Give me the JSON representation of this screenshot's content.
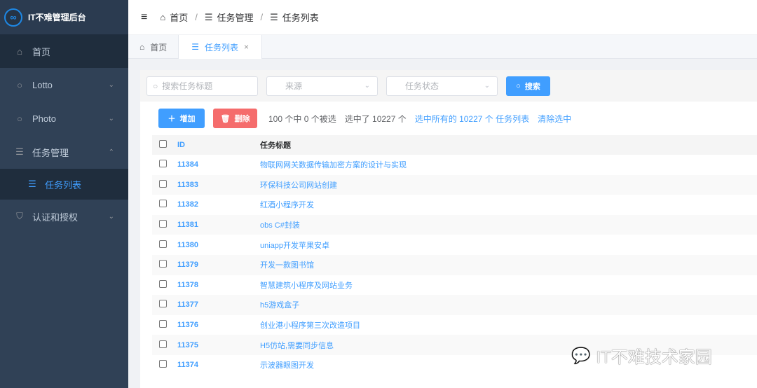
{
  "app": {
    "title": "IT不难管理后台",
    "logo_glyph": "∞"
  },
  "sidebar": {
    "items": [
      {
        "label": "首页",
        "icon": "home-icon"
      },
      {
        "label": "Lotto",
        "icon": "circle-icon"
      },
      {
        "label": "Photo",
        "icon": "circle-icon"
      },
      {
        "label": "任务管理",
        "icon": "list-icon"
      },
      {
        "label": "任务列表",
        "icon": "list-icon"
      },
      {
        "label": "认证和授权",
        "icon": "shield-icon"
      }
    ]
  },
  "header": {
    "breadcrumb": [
      "首页",
      "任务管理",
      "任务列表"
    ]
  },
  "tabs": [
    {
      "label": "首页"
    },
    {
      "label": "任务列表"
    }
  ],
  "filters": {
    "search_placeholder": "搜索任务标题",
    "source_placeholder": "来源",
    "status_placeholder": "任务状态",
    "search_button": "搜索"
  },
  "actions": {
    "add": "增加",
    "delete": "删除",
    "selected_info": "100 个中 0 个被选",
    "selected_total": "选中了 10227 个",
    "select_all": "选中所有的 10227 个 任务列表",
    "clear": "清除选中"
  },
  "table": {
    "columns": [
      "ID",
      "任务标题"
    ],
    "rows": [
      {
        "id": "11384",
        "title": "物联网网关数据传输加密方案的设计与实现"
      },
      {
        "id": "11383",
        "title": "环保科技公司网站创建"
      },
      {
        "id": "11382",
        "title": "红酒小程序开发"
      },
      {
        "id": "11381",
        "title": "obs C#封装"
      },
      {
        "id": "11380",
        "title": "uniapp开发苹果安卓"
      },
      {
        "id": "11379",
        "title": "开发一款图书馆"
      },
      {
        "id": "11378",
        "title": "智慧建筑小程序及网站业务"
      },
      {
        "id": "11377",
        "title": "h5游戏盒子"
      },
      {
        "id": "11376",
        "title": "创业港小程序第三次改造项目"
      },
      {
        "id": "11375",
        "title": "H5仿站,需要同步信息"
      },
      {
        "id": "11374",
        "title": "示波器眼图开发"
      }
    ]
  },
  "watermark": "IT不难技术家园",
  "colors": {
    "primary": "#409eff",
    "danger": "#f56c6c",
    "sidebar": "#304156"
  }
}
